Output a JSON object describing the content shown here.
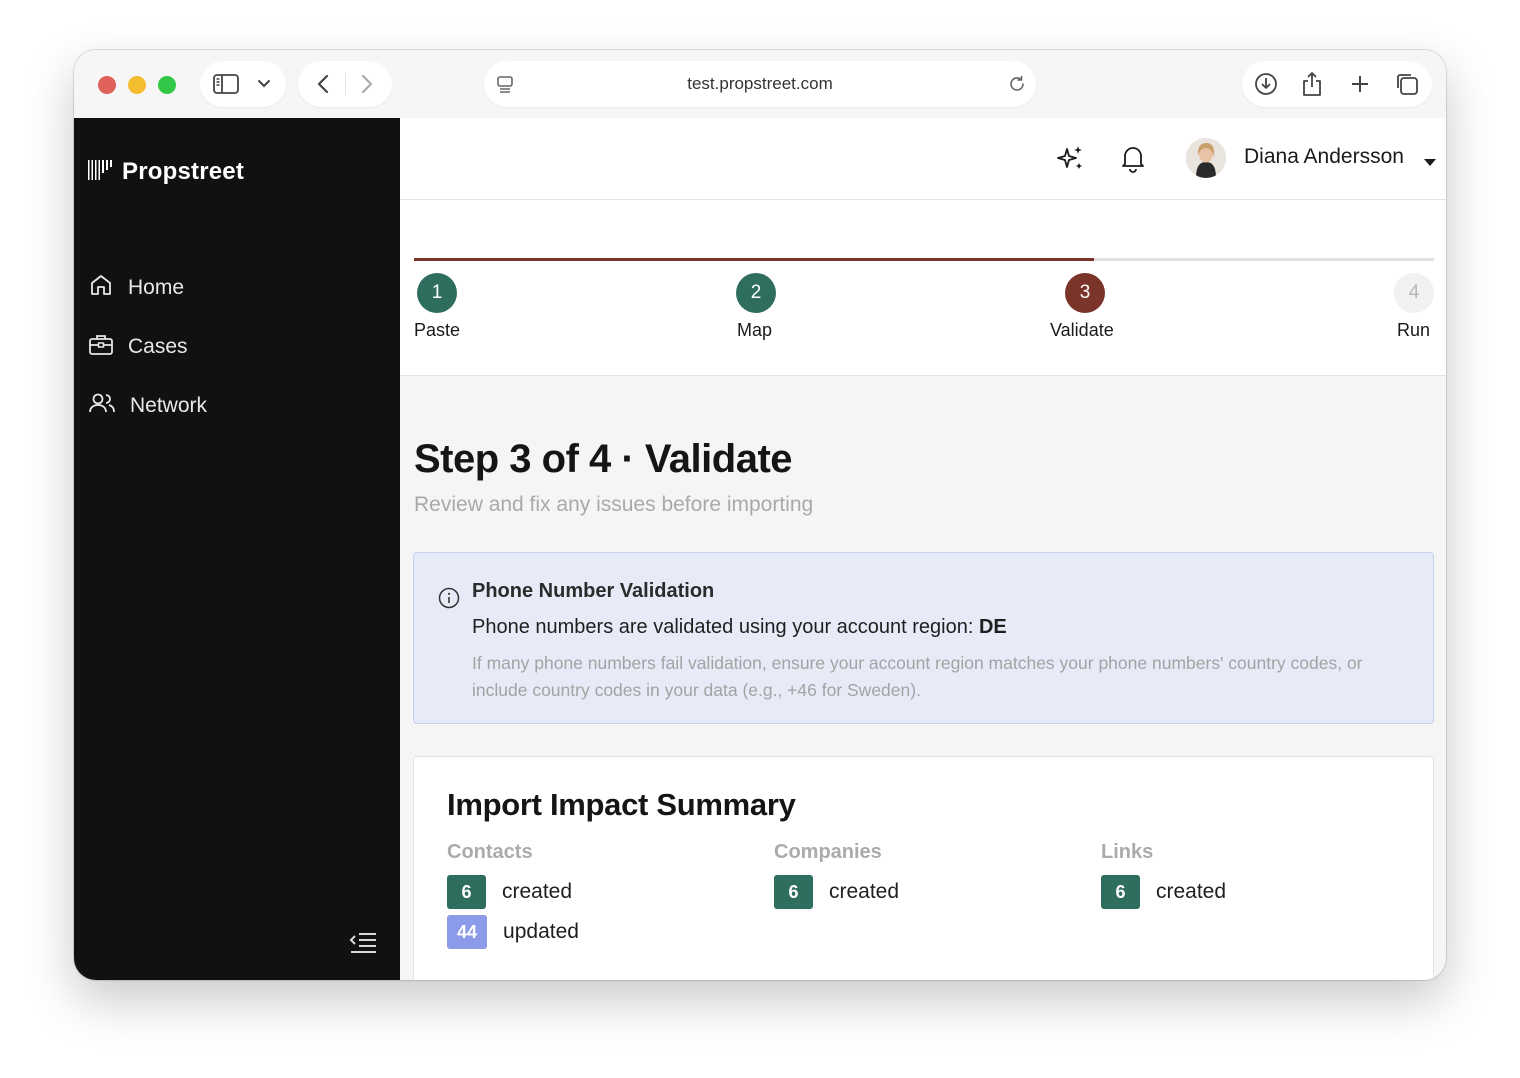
{
  "browser": {
    "url": "test.propstreet.com"
  },
  "sidebar": {
    "brand": "Propstreet",
    "items": [
      {
        "label": "Home",
        "icon": "home-icon"
      },
      {
        "label": "Cases",
        "icon": "briefcase-icon"
      },
      {
        "label": "Network",
        "icon": "users-icon"
      }
    ]
  },
  "header": {
    "user_name": "Diana Andersson"
  },
  "stepper": {
    "progress_percent": 66.7,
    "active_color": "#7a3429",
    "done_color": "#2f6e5f",
    "steps": [
      {
        "number": "1",
        "label": "Paste",
        "state": "done"
      },
      {
        "number": "2",
        "label": "Map",
        "state": "done"
      },
      {
        "number": "3",
        "label": "Validate",
        "state": "active"
      },
      {
        "number": "4",
        "label": "Run",
        "state": "pending"
      }
    ]
  },
  "page": {
    "title": "Step 3 of 4 · Validate",
    "subtitle": "Review and fix any issues before importing"
  },
  "info": {
    "title": "Phone Number Validation",
    "line_prefix": "Phone numbers are validated using your account region: ",
    "region": "DE",
    "note": "If many phone numbers fail validation, ensure your account region matches your phone numbers' country codes, or include country codes in your data (e.g., +46 for Sweden)."
  },
  "summary": {
    "title": "Import Impact Summary",
    "contacts": {
      "label": "Contacts",
      "created_count": "6",
      "created_label": "created",
      "updated_count": "44",
      "updated_label": "updated"
    },
    "companies": {
      "label": "Companies",
      "created_count": "6",
      "created_label": "created"
    },
    "links": {
      "label": "Links",
      "created_count": "6",
      "created_label": "created"
    }
  }
}
